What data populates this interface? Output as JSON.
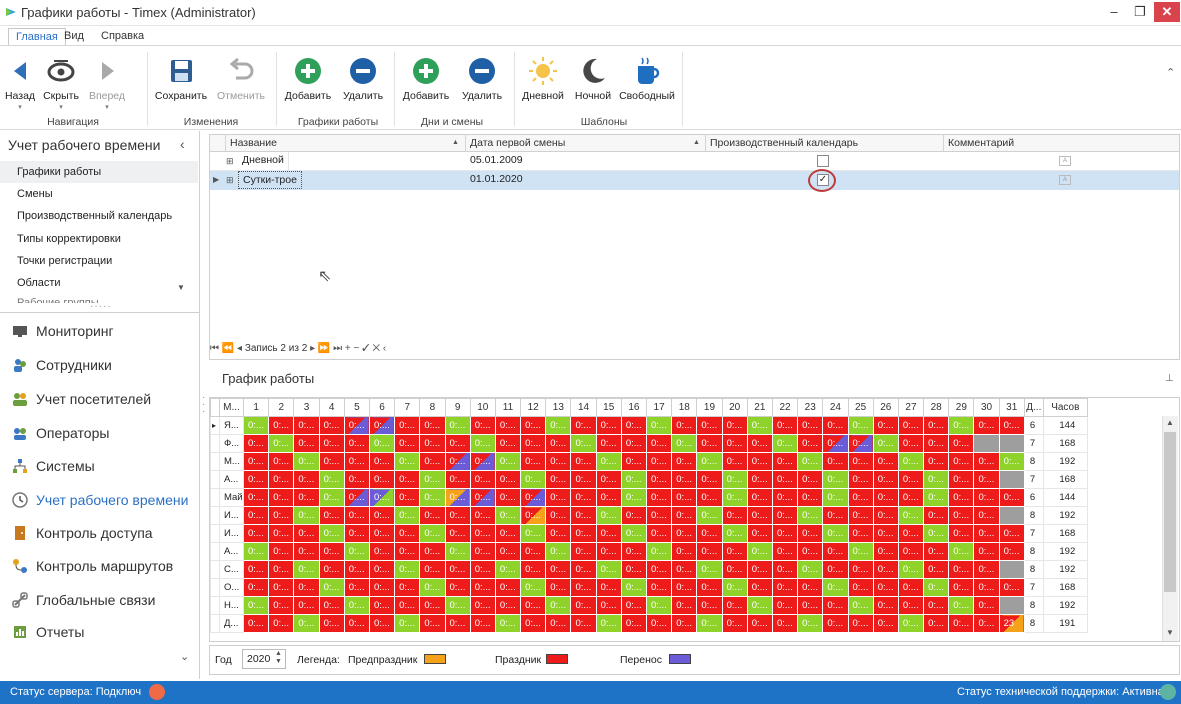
{
  "window": {
    "title": "Графики работы - Timex (Administrator)",
    "min": "–",
    "max": "❐",
    "close": "✕"
  },
  "menu": [
    "Главная",
    "Вид",
    "Справка"
  ],
  "ribbon": {
    "back": "Назад",
    "hide": "Скрыть",
    "forward": "Вперед",
    "save": "Сохранить",
    "undo": "Отменить",
    "add1": "Добавить",
    "del1": "Удалить",
    "add2": "Добавить",
    "del2": "Удалить",
    "day": "Дневной",
    "night": "Ночной",
    "free": "Свободный",
    "groups": {
      "nav": "Навигация",
      "changes": "Изменения",
      "schedules": "Графики работы",
      "days": "Дни и смены",
      "templates": "Шаблоны"
    }
  },
  "left_panel": {
    "title": "Учет рабочего времени",
    "items": [
      "Графики работы",
      "Смены",
      "Производственный календарь",
      "Типы корректировки",
      "Точки регистрации",
      "Области",
      "Рабочие группы"
    ],
    "nav": [
      "Мониторинг",
      "Сотрудники",
      "Учет посетителей",
      "Операторы",
      "Системы",
      "Учет рабочего времени",
      "Контроль доступа",
      "Контроль маршрутов",
      "Глобальные связи",
      "Отчеты"
    ]
  },
  "upper_grid": {
    "headers": [
      "Название",
      "Дата первой смены",
      "Производственный календарь",
      "Комментарий"
    ],
    "rows": [
      {
        "name": "Дневной",
        "date": "05.01.2009",
        "calendar": false
      },
      {
        "name": "Сутки-трое",
        "date": "01.01.2020",
        "calendar": true
      }
    ],
    "navigator": "Запись 2 из 2"
  },
  "lower": {
    "title": "График работы",
    "col_month": "М...",
    "col_days": "Д...",
    "col_hours": "Часов",
    "cell_text": "0:...",
    "day_numbers": [
      "1",
      "2",
      "3",
      "4",
      "5",
      "6",
      "7",
      "8",
      "9",
      "10",
      "11",
      "12",
      "13",
      "14",
      "15",
      "16",
      "17",
      "18",
      "19",
      "20",
      "21",
      "22",
      "23",
      "24",
      "25",
      "26",
      "27",
      "28",
      "29",
      "30",
      "31"
    ],
    "months": [
      "Я...",
      "Ф...",
      "М...",
      "А...",
      "Май",
      "И...",
      "И...",
      "А...",
      "С...",
      "О...",
      "Н...",
      "Д..."
    ],
    "days": [
      "6",
      "7",
      "8",
      "7",
      "6",
      "8",
      "7",
      "8",
      "8",
      "7",
      "8",
      "8"
    ],
    "hours": [
      "144",
      "168",
      "192",
      "168",
      "144",
      "192",
      "168",
      "192",
      "192",
      "168",
      "192",
      "191"
    ],
    "last_row_special": "23"
  },
  "bottom": {
    "year_label": "Год",
    "year_value": "2020",
    "legend_label": "Легенда:",
    "pre_holiday": "Предпраздник",
    "holiday": "Праздник",
    "transfer": "Перенос"
  },
  "colors": {
    "holiday": "#ee1b1b",
    "work": "#8fd32a",
    "pre_holiday": "#f5a11a",
    "transfer": "#6b5bd6",
    "statusbar": "#1f73c6"
  },
  "status": {
    "server": "Статус сервера: Подключ",
    "support": "Статус технической поддержки: Активна"
  }
}
